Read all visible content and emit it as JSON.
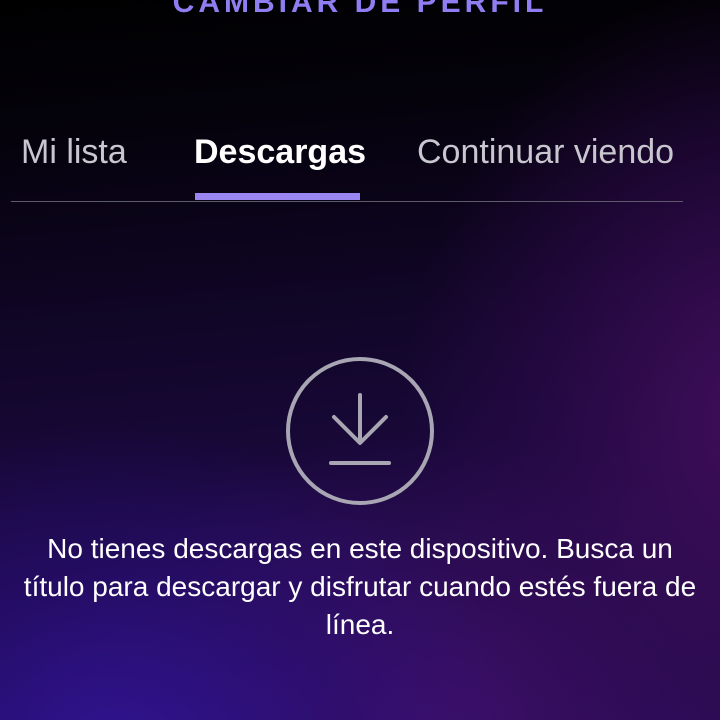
{
  "header": {
    "profile_link_label": "CAMBIAR DE PERFIL"
  },
  "tabs": [
    {
      "label": "Mi lista",
      "selected": false
    },
    {
      "label": "Descargas",
      "selected": true
    },
    {
      "label": "Continuar viendo",
      "selected": false
    }
  ],
  "empty_state": {
    "icon": "download-icon",
    "message": "No tienes descargas en este dispositivo. Busca un título para descargar y disfrutar cuando estés fuera de línea."
  },
  "colors": {
    "accent": "#9a86f0",
    "profile_link": "#8f7ef2",
    "background_top": "#000000",
    "background_bottom": "#220c52"
  }
}
